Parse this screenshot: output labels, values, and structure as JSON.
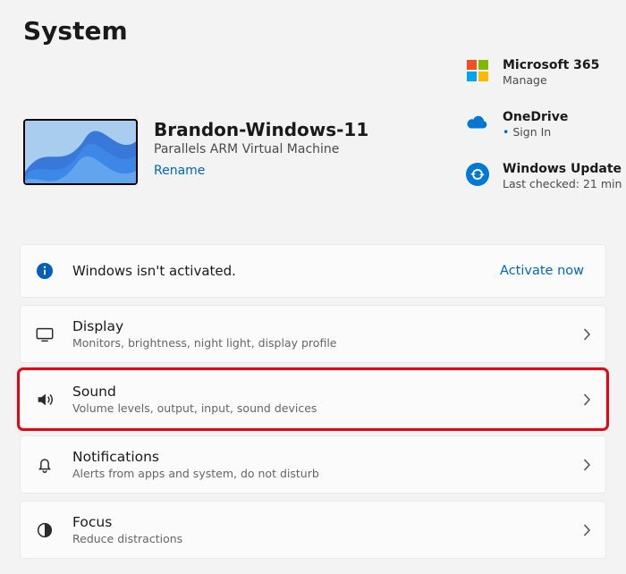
{
  "pageTitle": "System",
  "device": {
    "name": "Brandon-Windows-11",
    "subtitle": "Parallels ARM Virtual Machine",
    "renameLabel": "Rename"
  },
  "sideLinks": {
    "m365": {
      "title": "Microsoft 365",
      "sub": "Manage"
    },
    "onedrive": {
      "title": "OneDrive",
      "sub": "Sign In"
    },
    "wu": {
      "title": "Windows Update",
      "sub": "Last checked: 21 min"
    }
  },
  "activation": {
    "message": "Windows isn't activated.",
    "action": "Activate now"
  },
  "items": {
    "display": {
      "title": "Display",
      "sub": "Monitors, brightness, night light, display profile"
    },
    "sound": {
      "title": "Sound",
      "sub": "Volume levels, output, input, sound devices"
    },
    "notifications": {
      "title": "Notifications",
      "sub": "Alerts from apps and system, do not disturb"
    },
    "focus": {
      "title": "Focus",
      "sub": "Reduce distractions"
    }
  }
}
